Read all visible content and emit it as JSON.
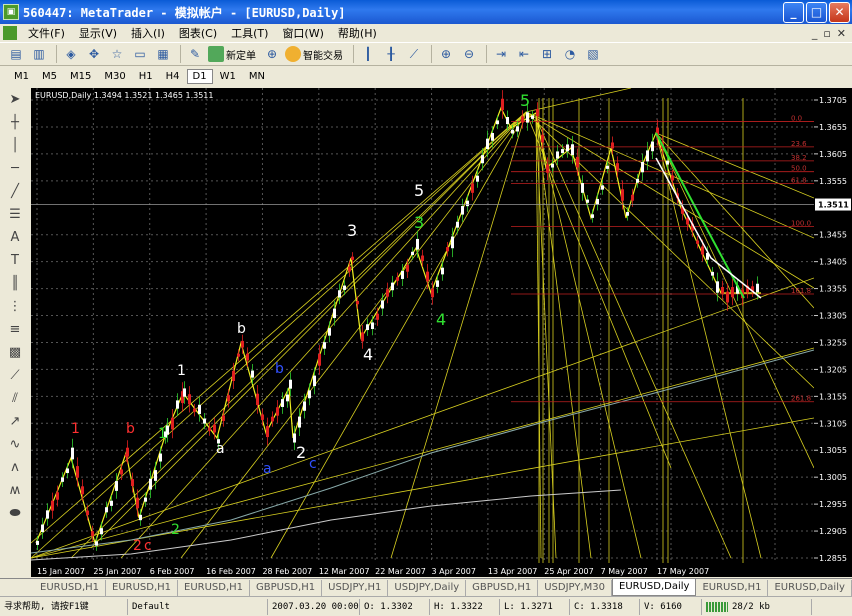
{
  "window": {
    "title": "560447: MetaTrader - 模拟帐户 - [EURUSD,Daily]",
    "icon": "metatrader-icon"
  },
  "menu": [
    "文件(F)",
    "显示(V)",
    "插入(I)",
    "图表(C)",
    "工具(T)",
    "窗口(W)",
    "帮助(H)"
  ],
  "toolbar": {
    "new_order": "新定单",
    "expert": "智能交易"
  },
  "timeframes": [
    "M1",
    "M5",
    "M15",
    "M30",
    "H1",
    "H4",
    "D1",
    "W1",
    "MN"
  ],
  "active_timeframe": "D1",
  "chart": {
    "info": "EURUSD,Daily  1.3494 1.3521 1.3465 1.3511",
    "current_price": "1.3511",
    "price_ticks": [
      "1.3705",
      "1.3655",
      "1.3605",
      "1.3555",
      "1.3455",
      "1.3405",
      "1.3355",
      "1.3305",
      "1.3255",
      "1.3205",
      "1.3155",
      "1.3105",
      "1.3055",
      "1.3005",
      "1.2955",
      "1.2905",
      "1.2855"
    ],
    "date_ticks": [
      "15 Jan 2007",
      "25 Jan 2007",
      "6 Feb 2007",
      "16 Feb 2007",
      "28 Feb 2007",
      "12 Mar 2007",
      "22 Mar 2007",
      "3 Apr 2007",
      "13 Apr 2007",
      "25 Apr 2007",
      "7 May 2007",
      "17 May 2007"
    ],
    "fib_levels": [
      "0.0",
      "23.6",
      "38.2",
      "50.0",
      "61.8",
      "100.0",
      "161.8",
      "261.8"
    ],
    "wave_labels": [
      {
        "text": "1",
        "color": "#ff3030"
      },
      {
        "text": "b",
        "color": "#ff3030"
      },
      {
        "text": "2",
        "color": "#ff3030"
      },
      {
        "text": "c",
        "color": "#ff3030"
      },
      {
        "text": "1",
        "color": "#30e030"
      },
      {
        "text": "2",
        "color": "#30e030"
      },
      {
        "text": "1",
        "color": "#ffffff"
      },
      {
        "text": "a",
        "color": "#ffffff"
      },
      {
        "text": "b",
        "color": "#ffffff"
      },
      {
        "text": "a",
        "color": "#3050ff"
      },
      {
        "text": "b",
        "color": "#3050ff"
      },
      {
        "text": "c",
        "color": "#3050ff"
      },
      {
        "text": "2",
        "color": "#ffffff"
      },
      {
        "text": "3",
        "color": "#ffffff"
      },
      {
        "text": "4",
        "color": "#ffffff"
      },
      {
        "text": "5",
        "color": "#ffffff"
      },
      {
        "text": "3",
        "color": "#30e030"
      },
      {
        "text": "4",
        "color": "#30e030"
      },
      {
        "text": "5",
        "color": "#30e030"
      }
    ]
  },
  "tabs": [
    "EURUSD,H1",
    "EURUSD,H1",
    "EURUSD,H1",
    "GBPUSD,H1",
    "USDJPY,H1",
    "USDJPY,Daily",
    "GBPUSD,H1",
    "USDJPY,M30",
    "EURUSD,Daily",
    "EURUSD,H1",
    "EURUSD,Daily"
  ],
  "active_tab": 8,
  "status": {
    "help": "寻求帮助, 请按F1键",
    "profile": "Default",
    "datetime": "2007.03.20 00:00",
    "open": "O: 1.3302",
    "high": "H: 1.3322",
    "low": "L: 1.3271",
    "close": "C: 1.3318",
    "volume": "V: 6160",
    "traffic": "28/2 kb"
  }
}
